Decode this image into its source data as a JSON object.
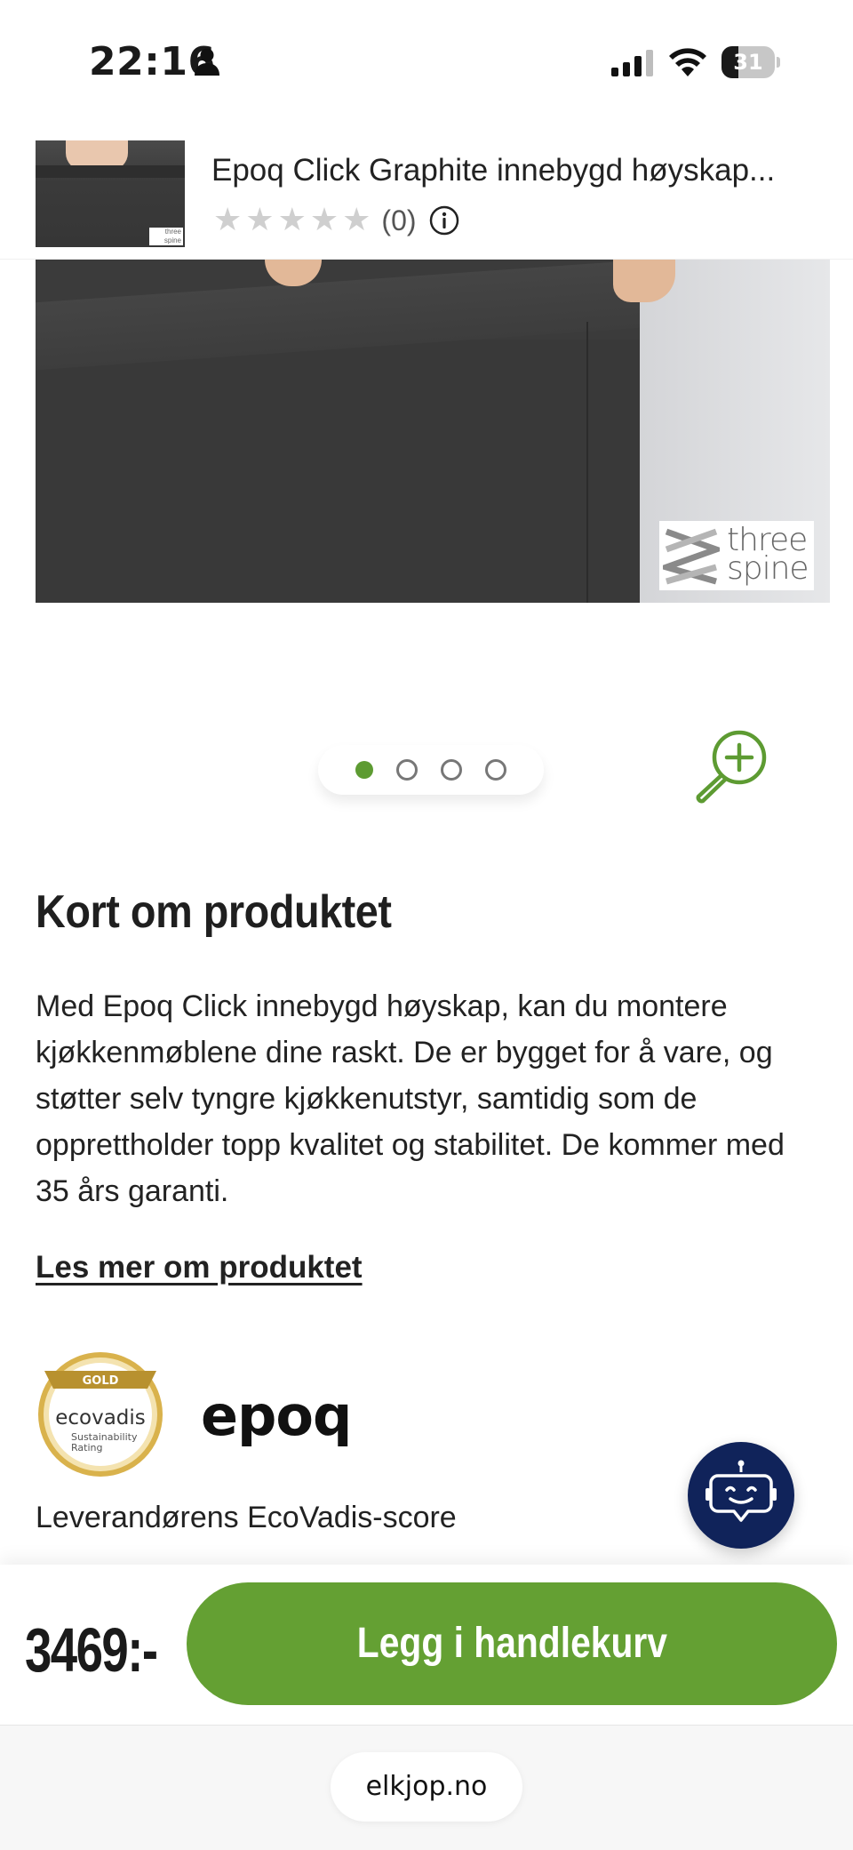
{
  "status_bar": {
    "time": "22:16",
    "battery_level": "31",
    "icons": [
      "person-icon",
      "signal-icon",
      "wifi-icon",
      "battery-icon"
    ]
  },
  "product_header": {
    "title": "Epoq Click Graphite innebygd høyskap...",
    "rating_stars": 5,
    "rating_filled": 0,
    "rating_count": "(0)",
    "star_glyph": "★"
  },
  "product_image": {
    "watermark_text": "three spine",
    "carousel_total": 4,
    "carousel_active": 1
  },
  "about": {
    "heading": "Kort om produktet",
    "description": "Med Epoq Click innebygd høyskap, kan du montere kjøkkenmøblene dine raskt. De er bygget for å vare, og støtter selv tyngre kjøkkenutstyr, samtidig som de opprettholder topp kvalitet og stabilitet. De kommer med 35 års garanti.",
    "read_more": "Les mer om produktet",
    "ecovadis_badge": {
      "level": "GOLD",
      "name": "ecovadis",
      "line1": "Sustainability",
      "line2": "Rating"
    },
    "brand": "epoq",
    "ecovadis_caption": "Leverandørens EcoVadis-score"
  },
  "buy_bar": {
    "price": "3469:-",
    "add_to_cart": "Legg i handlekurv"
  },
  "browser": {
    "url": "elkjop.no"
  },
  "colors": {
    "accent_green": "#64a033",
    "chat_navy": "#10235a",
    "ecovadis_gold": "#c9a441"
  }
}
